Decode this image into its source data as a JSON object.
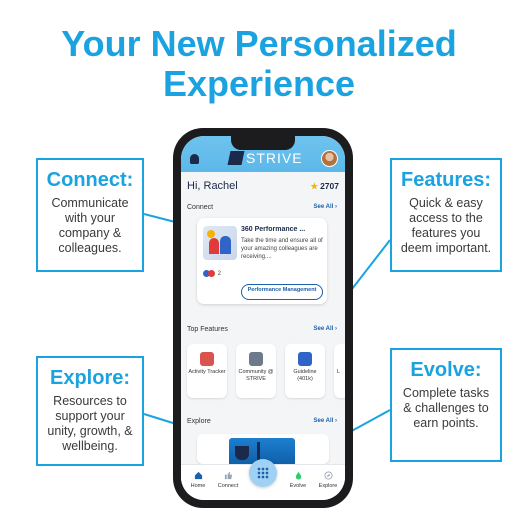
{
  "headline": {
    "line1": "Your New Personalized",
    "line2": "Experience"
  },
  "colors": {
    "brand": "#1aa3e0",
    "navy": "#1b2a4a",
    "link": "#1d5fa8"
  },
  "callouts": {
    "connect": {
      "title": "Connect:",
      "body": [
        "Communicate",
        "with your",
        "company &",
        "colleagues."
      ]
    },
    "features": {
      "title": "Features:",
      "body": [
        "Quick & easy",
        "access to the",
        "features you",
        "deem important."
      ]
    },
    "explore": {
      "title": "Explore:",
      "body": [
        "Resources to",
        "support your",
        "unity, growth, &",
        "wellbeing."
      ]
    },
    "evolve": {
      "title": "Evolve:",
      "body": [
        "Complete tasks",
        "& challenges to",
        "earn points."
      ]
    }
  },
  "app": {
    "logo_text": "STRIVE",
    "greeting": "Hi, Rachel",
    "points": "2707",
    "icons": {
      "notifications": "bell-icon",
      "points": "star-icon"
    },
    "connect": {
      "title": "Connect",
      "see_all": "See All",
      "card": {
        "title": "360 Performance ...",
        "description": "Take the time and ensure all of your amazing colleagues are receiving....",
        "reactions": "2",
        "button": "Performance Management"
      }
    },
    "top_features": {
      "title": "Top Features",
      "see_all": "See All",
      "tiles": [
        {
          "label": "Activity Tracker",
          "icon": "activity-icon",
          "color": "#d9534f"
        },
        {
          "label": "Community @ STRIVE",
          "icon": "phone-icon",
          "color": "#6c7a89"
        },
        {
          "label": "Guideline (401k)",
          "icon": "laptop-icon",
          "color": "#2f64c8"
        },
        {
          "label": "L",
          "icon": "generic-icon",
          "color": "#999999"
        }
      ]
    },
    "explore": {
      "title": "Explore",
      "see_all": "See All"
    },
    "tabbar": {
      "home": "Home",
      "connect": "Connect",
      "evolve": "Evolve",
      "explore": "Explore"
    }
  }
}
